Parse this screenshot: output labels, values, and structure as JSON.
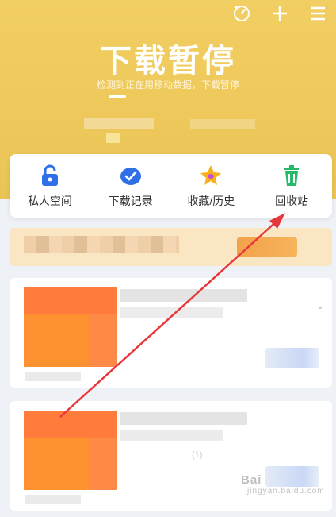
{
  "header": {
    "title": "下载暂停",
    "subtitle": "检测到正在用移动数据，下载暂停",
    "icons": [
      "speed-icon",
      "plus-icon",
      "menu-icon"
    ]
  },
  "quick_actions": [
    {
      "label": "私人空间",
      "icon": "unlock-icon",
      "color": "#2f6fe8"
    },
    {
      "label": "下载记录",
      "icon": "download-check-icon",
      "color": "#2f6fe8"
    },
    {
      "label": "收藏/历史",
      "icon": "star-icon",
      "color": "#f5b21a"
    },
    {
      "label": "回收站",
      "icon": "trash-icon",
      "color": "#27b86a"
    }
  ],
  "card2": {
    "meta": "(1)"
  },
  "watermark": {
    "brand": "Bai",
    "sub": "jingyan.baidu.com"
  },
  "colors": {
    "hero": "#eec85a",
    "accent": "#2f6fe8",
    "arrow": "#e8373b"
  }
}
